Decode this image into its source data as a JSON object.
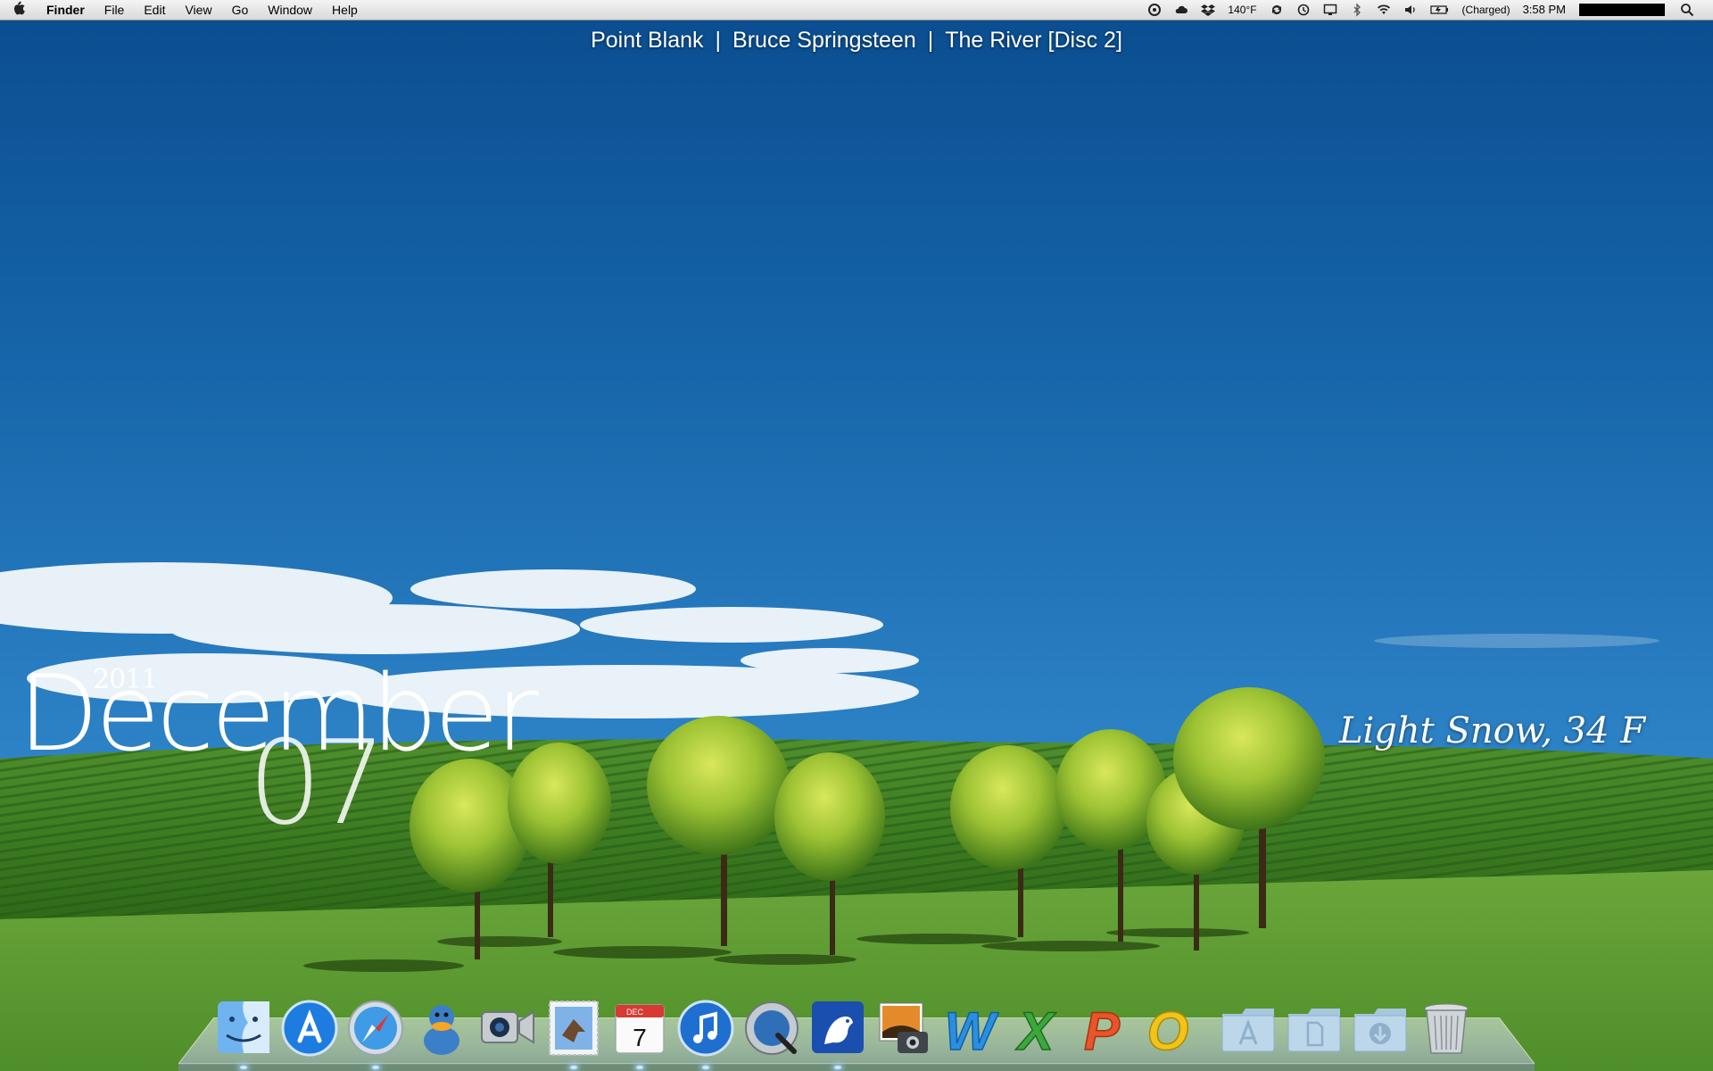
{
  "menubar": {
    "apple_icon": "apple-icon",
    "app_name": "Finder",
    "menus": [
      "File",
      "Edit",
      "View",
      "Go",
      "Window",
      "Help"
    ],
    "status": {
      "temperature": "140°F",
      "battery": "(Charged)",
      "time": "3:58 PM",
      "icons": [
        "istat-icon",
        "cloud-icon",
        "dropbox-icon",
        "sync-icon",
        "time-machine-icon",
        "display-icon",
        "bluetooth-icon",
        "wifi-icon",
        "volume-icon",
        "battery-icon",
        "spotlight-icon"
      ]
    }
  },
  "now_playing": {
    "track": "Point Blank",
    "artist": "Bruce Springsteen",
    "album": "The River [Disc 2]",
    "separator": "|"
  },
  "date_widget": {
    "year": "2011",
    "month": "December",
    "day": "07"
  },
  "weather": {
    "text": "Light Snow, 34 F"
  },
  "dock": {
    "apps": [
      "finder",
      "app-store",
      "safari",
      "adium",
      "facetime",
      "mail",
      "ical",
      "itunes",
      "quicktime",
      "vuze",
      "iphoto",
      "word",
      "excel",
      "powerpoint",
      "outlook"
    ],
    "calendar_month": "DEC",
    "calendar_day": "7",
    "word_letter": "W",
    "excel_letter": "X",
    "powerpoint_letter": "P",
    "outlook_letter": "O",
    "folders": [
      "applications-folder",
      "documents-folder",
      "downloads-folder"
    ],
    "trash": "trash"
  }
}
